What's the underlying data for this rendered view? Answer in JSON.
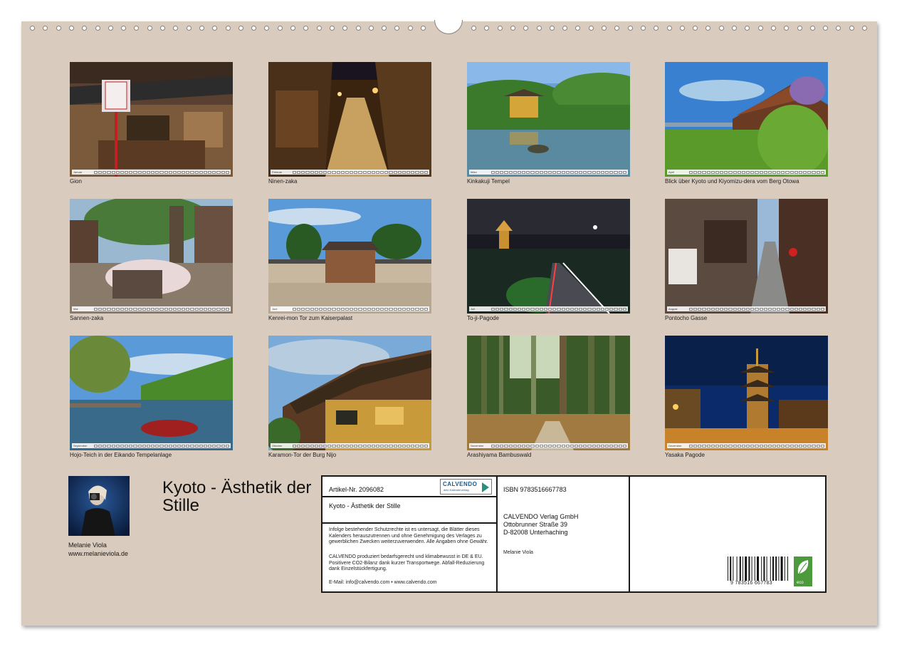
{
  "calendar": {
    "title": "Kyoto - Ästhetik der Stille",
    "months": [
      {
        "month": "Januar",
        "caption": "Gion"
      },
      {
        "month": "Februar",
        "caption": "Ninen-zaka"
      },
      {
        "month": "März",
        "caption": "Kinkakuji Tempel"
      },
      {
        "month": "April",
        "caption": "Blick über Kyoto und Kiyomizu-dera vom Berg Otowa"
      },
      {
        "month": "Mai",
        "caption": "Sannen-zaka"
      },
      {
        "month": "Juni",
        "caption": "Kenrei-mon Tor zum Kaiserpalast"
      },
      {
        "month": "Juli",
        "caption": "To-ji-Pagode"
      },
      {
        "month": "August",
        "caption": "Pontocho Gasse"
      },
      {
        "month": "September",
        "caption": "Hojo-Teich in der Eikando Tempelanlage"
      },
      {
        "month": "Oktober",
        "caption": "Karamon-Tor der Burg Nijo"
      },
      {
        "month": "November",
        "caption": "Arashiyama Bambuswald"
      },
      {
        "month": "Dezember",
        "caption": "Yasaka Pagode"
      }
    ]
  },
  "author": {
    "name": "Melanie Viola",
    "website": "www.melanieviola.de"
  },
  "info": {
    "article_no": "Artikel-Nr. 2096082",
    "title": "Kyoto - Ästhetik der Stille",
    "logo_text": "CALVENDO",
    "logo_sub": "dein Kalenderverlag",
    "legal": "Infolge bestehender Schutzrechte ist es untersagt, die Blätter dieses Kalenders herauszutrennen und ohne Genehmigung des Verlages zu gewerblichen Zwecken weiterzuverwenden. Alle Angaben ohne Gewähr.",
    "eco_text": "CALVENDO produziert bedarfsgerecht und klimabewusst in DE & EU. Positivere CO2-Bilanz dank kurzer Transportwege. Abfall-Reduzierung dank Einzelstückfertigung.",
    "contact": "E-Mail: info@calvendo.com • www.calvendo.com",
    "isbn": "ISBN 9783516667783",
    "publisher": [
      "CALVENDO Verlag GmbH",
      "Ottobrunner Straße 39",
      "D-82008 Unterhaching"
    ],
    "photographer": "Melanie Viola",
    "barcode_number": "9 783516 667783",
    "eco_badge": "eco"
  },
  "colors": {
    "page_background": "#d9cbbd",
    "logo_blue": "#1b5a8c",
    "eco_green": "#4d9a3c"
  }
}
